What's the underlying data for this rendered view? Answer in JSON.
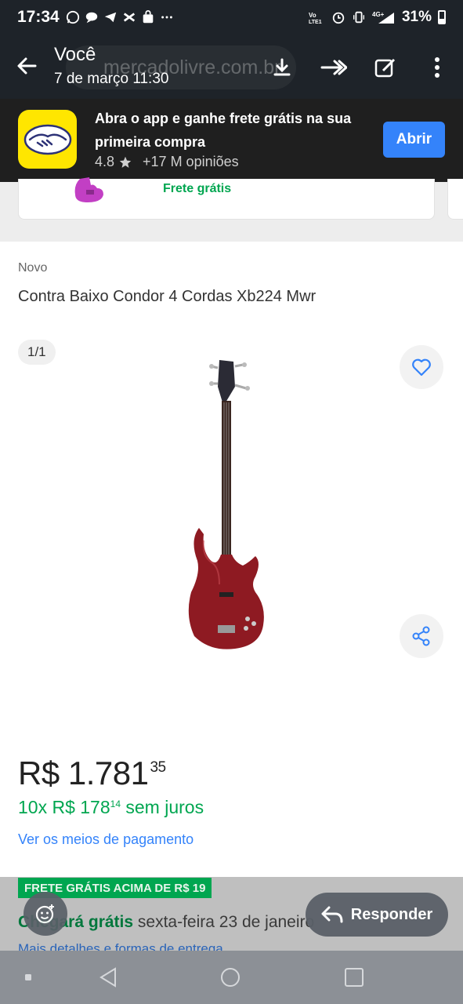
{
  "status_bar": {
    "time": "17:34",
    "battery": "31%",
    "icons": [
      "whatsapp-icon",
      "chat-icon",
      "telegram-icon",
      "transfer-icon",
      "bag-icon",
      "more-icon",
      "volte-icon",
      "alarm-icon",
      "vibrate-icon",
      "4g-icon",
      "battery-icon"
    ]
  },
  "chat_header": {
    "sender": "Você",
    "date": "7 de março 11:30",
    "url": "mercadolivre.com.br"
  },
  "app_banner": {
    "text": "Abra o app e ganhe frete grátis na sua primeira compra",
    "rating": "4.8",
    "reviews": "+17 M opiniões",
    "button": "Abrir",
    "brand_color": "#ffe600",
    "button_color": "#3483fa"
  },
  "previous_card": {
    "shipping": "Frete grátis"
  },
  "product": {
    "condition": "Novo",
    "title": "Contra Baixo Condor 4 Cordas Xb224 Mwr",
    "image_counter": "1/1",
    "price_main": "R$ 1.781",
    "price_cents": "35",
    "installments_prefix": "10x R$ 178",
    "installments_cents": "14",
    "installments_suffix": " sem juros",
    "payment_link": "Ver os meios de pagamento",
    "free_shipping_badge": "FRETE GRÁTIS ACIMA DE R$ 19",
    "arrival_green": "Chegará grátis",
    "arrival_rest": " sexta-feira 23 de janeiro",
    "details_link": "Mais detalhes e formas de entrega",
    "accent_green": "#00a650"
  },
  "chat_actions": {
    "reply": "Responder"
  }
}
